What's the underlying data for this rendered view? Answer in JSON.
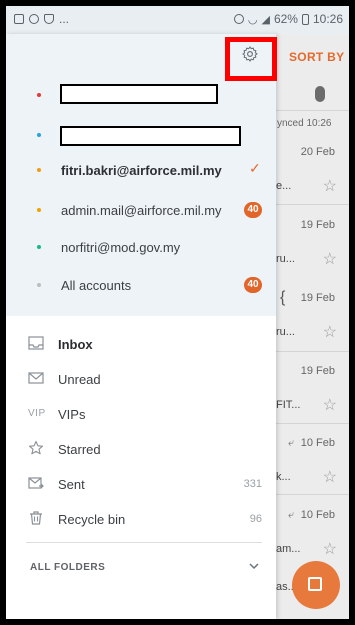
{
  "status_bar": {
    "battery": "62%",
    "time": "10:26",
    "ellipsis": "..."
  },
  "mail_list": {
    "sort_label": "SORT BY",
    "synced_text": "ynced 10:26",
    "items": [
      {
        "date": "20 Feb",
        "preview": "e..."
      },
      {
        "date": "19 Feb",
        "preview": "ru..."
      },
      {
        "date": "19 Feb",
        "preview": "ru...",
        "mark": "{"
      },
      {
        "date": "19 Feb",
        "preview": "FIT..."
      },
      {
        "date": "10 Feb",
        "preview": "k..."
      },
      {
        "date": "10 Feb",
        "preview": "am..."
      },
      {
        "date": "",
        "preview": "as..."
      }
    ],
    "reply_icon_glyph": "⤶"
  },
  "drawer": {
    "accounts": [
      {
        "label": "",
        "redacted": true,
        "dot_color": "#e53935"
      },
      {
        "label": "",
        "redacted": true,
        "dot_color": "#29a0e0"
      },
      {
        "label": "fitri.bakri@airforce.mil.my",
        "dot_color": "#f39c12",
        "selected": true
      },
      {
        "label": "admin.mail@airforce.mil.my",
        "dot_color": "#f1a100",
        "badge": "40"
      },
      {
        "label": "norfitri@mod.gov.my",
        "dot_color": "#1bb58d"
      },
      {
        "label": "All accounts",
        "dot_color": "#bdbdbd",
        "badge": "40"
      }
    ],
    "folders": [
      {
        "label": "Inbox",
        "icon": "inbox-icon",
        "count": ""
      },
      {
        "label": "Unread",
        "icon": "envelope-icon",
        "count": ""
      },
      {
        "label": "VIPs",
        "icon": "vip-icon",
        "icon_text": "VIP",
        "count": ""
      },
      {
        "label": "Starred",
        "icon": "star-icon",
        "count": ""
      },
      {
        "label": "Sent",
        "icon": "sent-icon",
        "count": "331"
      },
      {
        "label": "Recycle bin",
        "icon": "trash-icon",
        "count": "96"
      }
    ],
    "all_folders_label": "ALL FOLDERS",
    "check_glyph": "✓"
  },
  "colors": {
    "accent": "#e36a2c",
    "highlight_box": "#ff0000",
    "drawer_top_bg": "#eef3f7"
  }
}
